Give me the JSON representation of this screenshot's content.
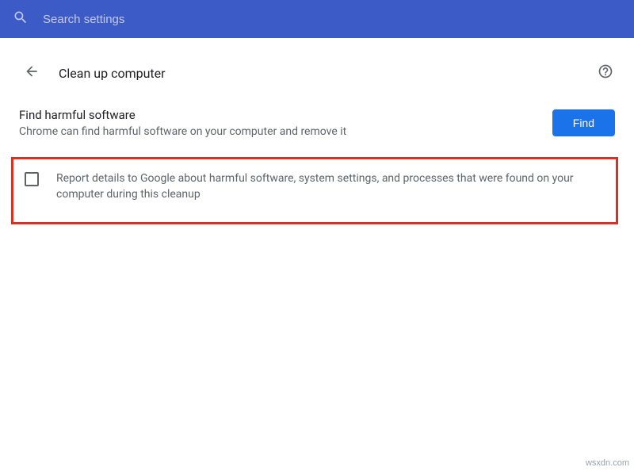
{
  "search": {
    "placeholder": "Search settings"
  },
  "header": {
    "title": "Clean up computer"
  },
  "find": {
    "title": "Find harmful software",
    "description": "Chrome can find harmful software on your computer and remove it",
    "button": "Find"
  },
  "report": {
    "text": "Report details to Google about harmful software, system settings, and processes that were found on your computer during this cleanup",
    "checked": false
  },
  "watermark": "wsxdn.com"
}
